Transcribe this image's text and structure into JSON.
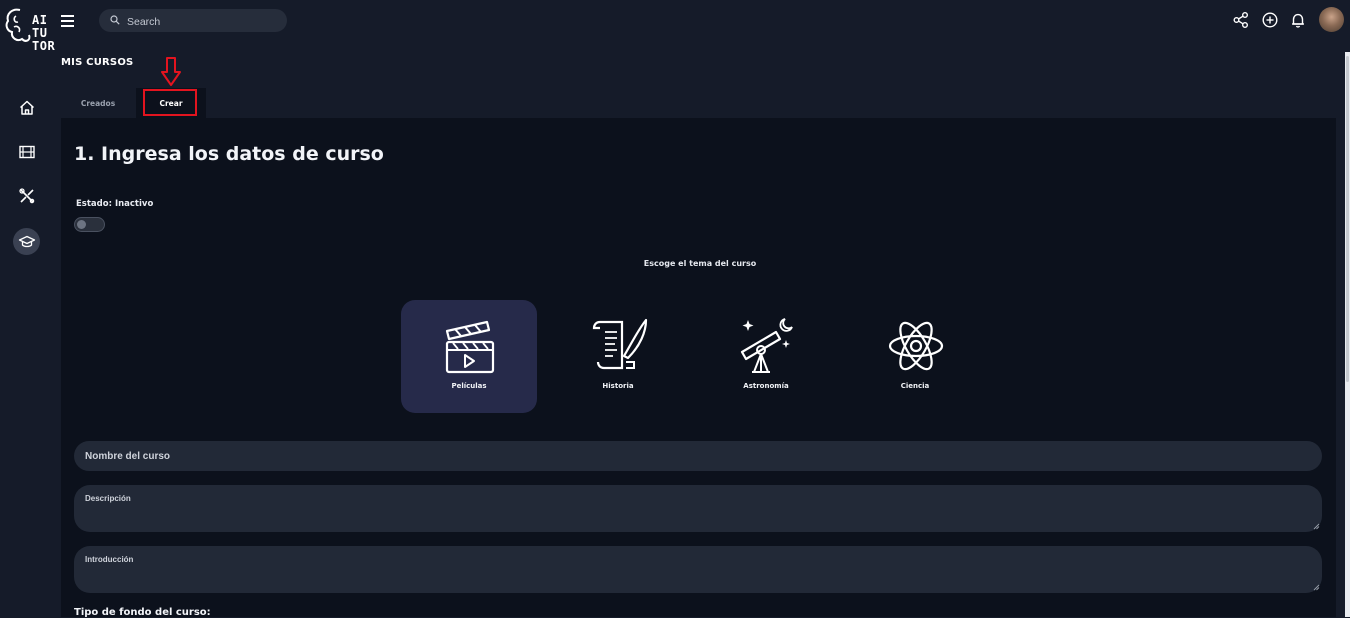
{
  "brand": {
    "logo_text_line1": "AI",
    "logo_text_line2": "TU",
    "logo_text_line3": "TOR"
  },
  "search": {
    "placeholder": "Search"
  },
  "topbar_icons": [
    "share-icon",
    "add-circle-icon",
    "bell-icon"
  ],
  "sidebar": {
    "items": [
      {
        "name": "home-icon"
      },
      {
        "name": "film-icon"
      },
      {
        "name": "tools-icon"
      },
      {
        "name": "graduation-cap-icon",
        "active": true
      }
    ]
  },
  "page": {
    "section_title": "MIS CURSOS"
  },
  "tabs": [
    {
      "label": "Creados",
      "active": false
    },
    {
      "label": "Crear",
      "active": true
    }
  ],
  "form": {
    "heading": "1. Ingresa los datos de curso",
    "status_label": "Estado: Inactivo",
    "status_enabled": false,
    "theme_prompt": "Escoge el tema del curso",
    "themes": [
      {
        "label": "Películas",
        "icon": "clapperboard-icon",
        "selected": true
      },
      {
        "label": "Historia",
        "icon": "scroll-quill-icon",
        "selected": false
      },
      {
        "label": "Astronomía",
        "icon": "telescope-icon",
        "selected": false
      },
      {
        "label": "Ciencia",
        "icon": "atom-icon",
        "selected": false
      }
    ],
    "name_placeholder": "Nombre del curso",
    "description_placeholder": "Descripción",
    "introduction_placeholder": "Introducción",
    "background_type_label": "Tipo de fondo del curso:"
  },
  "colors": {
    "background": "#151b29",
    "panel": "#0c111c",
    "selected_card": "#262a4a",
    "highlight": "#e3141f",
    "field": "#222937"
  }
}
